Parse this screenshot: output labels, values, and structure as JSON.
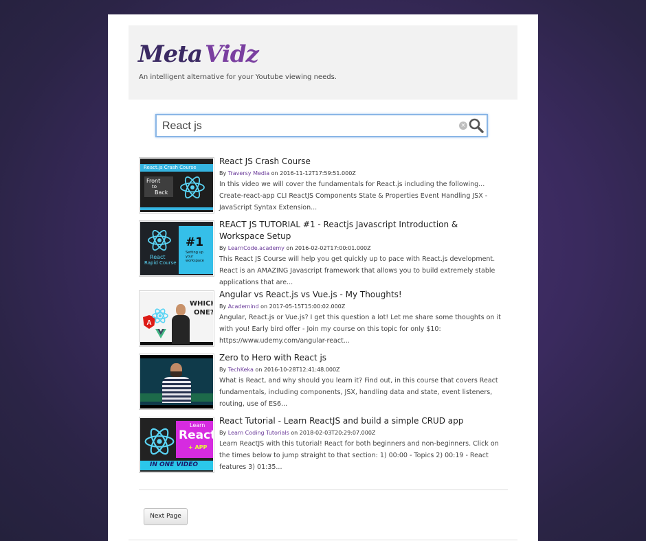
{
  "brand": {
    "name_part1": "Meta",
    "name_part2": "Vidz",
    "tagline": "An intelligent alternative for your Youtube viewing needs."
  },
  "search": {
    "value": "React js",
    "clear_icon": "clear-icon",
    "search_icon": "search-icon"
  },
  "results": [
    {
      "title": "React JS Crash Course",
      "by": "By",
      "channel": "Traversy Media",
      "on": "on",
      "date": "2016-11-12T17:59:51.000Z",
      "description": "In this video we will cover the fundamentals for React.js including the following... Create-react-app CLI ReactJS Components State & Properties Event Handling JSX - JavaScript Syntax Extension...",
      "thumb_text": [
        "React.js Crash Course",
        "Front",
        "to",
        "Back"
      ]
    },
    {
      "title": "REACT JS TUTORIAL #1 - Reactjs Javascript Introduction & Workspace Setup",
      "by": "By",
      "channel": "LearnCode.academy",
      "on": "on",
      "date": "2016-02-02T17:00:01.000Z",
      "description": "This React JS Course will help you get quickly up to pace with React.js development. React is an AMAZING Javascript framework that allows you to build extremely stable applications that are...",
      "thumb_text": [
        "React",
        "Rapid Course",
        "#1",
        "Setting up",
        "your",
        "workspace"
      ]
    },
    {
      "title": "Angular vs React.js vs Vue.js - My Thoughts!",
      "by": "By",
      "channel": "Academind",
      "on": "on",
      "date": "2017-05-15T15:00:02.000Z",
      "description": "Angular, React.js or Vue.js? I get this question a lot! Let me share some thoughts on it with you! Early bird offer - Join my course on this topic for only $10: https://www.udemy.com/angular-react...",
      "thumb_text": [
        "WHICH",
        "ONE?"
      ]
    },
    {
      "title": "Zero to Hero with React js",
      "by": "By",
      "channel": "TechKeka",
      "on": "on",
      "date": "2016-10-28T12:41:48.000Z",
      "description": "What is React, and why should you learn it? Find out, in this course that covers React fundamentals, including components, JSX, handling data and state, event listeners, routing, use of ES6...",
      "thumb_text": []
    },
    {
      "title": "React Tutorial - Learn ReactJS and build a simple CRUD app",
      "by": "By",
      "channel": "Learn Coding Tutorials",
      "on": "on",
      "date": "2018-02-03T20:29:07.000Z",
      "description": "Learn ReactJS with this tutorial! React for both beginners and non-beginners. Click on the times below to jump straight to that section: 1) 00:00 - Topics 2) 00:19 - React features 3) 01:35...",
      "thumb_text": [
        "Learn",
        "React",
        "+ APP",
        "IN ONE VIDEO"
      ]
    }
  ],
  "pagination": {
    "next_label": "Next Page"
  }
}
